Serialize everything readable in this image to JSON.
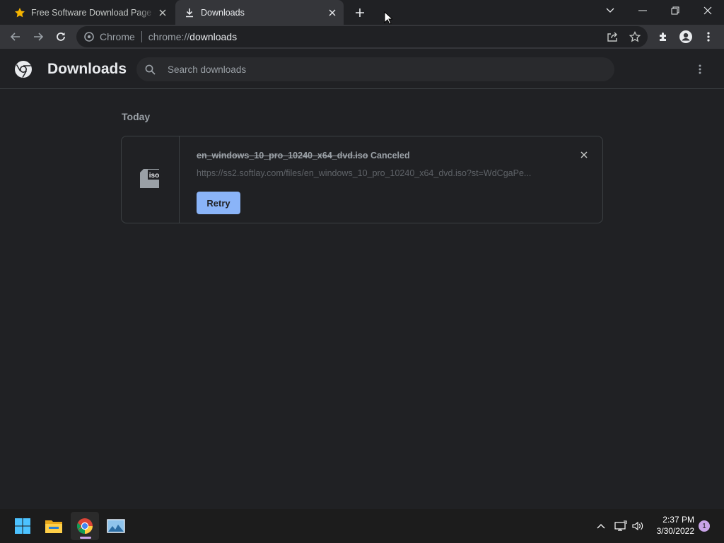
{
  "browser": {
    "tabs": [
      {
        "title": "Free Software Download Page - Softlay",
        "favicon": "star-icon",
        "active": false
      },
      {
        "title": "Downloads",
        "favicon": "download-icon",
        "active": true
      }
    ],
    "address_bar": {
      "chip_label": "Chrome",
      "scheme": "chrome://",
      "host": "downloads"
    }
  },
  "downloads_page": {
    "title": "Downloads",
    "search_placeholder": "Search downloads",
    "section_label": "Today",
    "items": [
      {
        "file_name": "en_windows_10_pro_10240_x64_dvd.iso",
        "status": "Canceled",
        "url": "https://ss2.softlay.com/files/en_windows_10_pro_10240_x64_dvd.iso?st=WdCgaPe...",
        "file_icon_label": "iso",
        "action_label": "Retry"
      }
    ]
  },
  "taskbar": {
    "apps": [
      "start-button",
      "file-explorer",
      "chrome",
      "photos"
    ],
    "time": "2:37 PM",
    "date": "3/30/2022",
    "notification_count": "1"
  },
  "colors": {
    "background": "#202124",
    "toolbar": "#35363a",
    "accent": "#8ab4f8",
    "taskbar": "#1c1c1c"
  }
}
